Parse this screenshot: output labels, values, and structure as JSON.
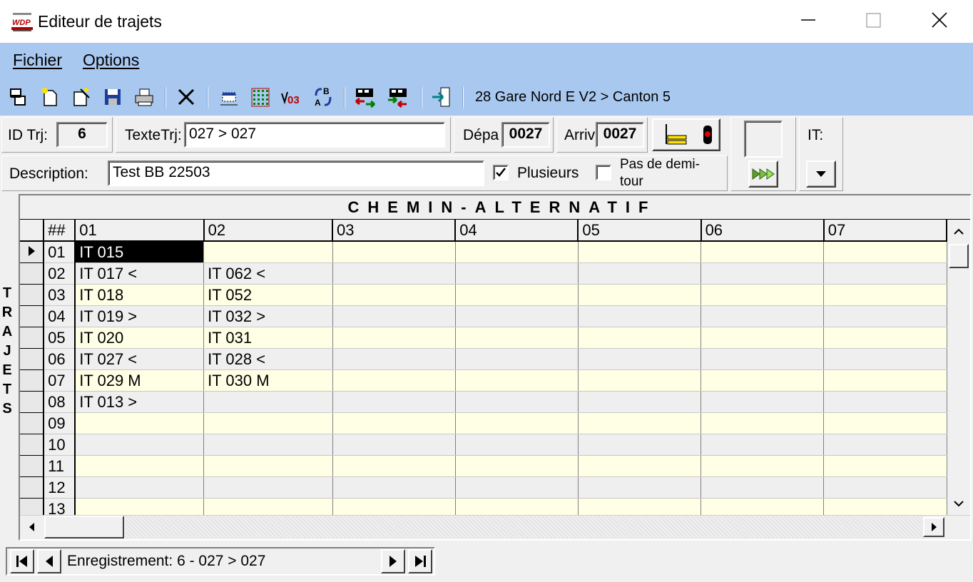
{
  "window": {
    "title": "Editeur de trajets",
    "app_icon": "wdp-logo-icon",
    "app_icon_text": "WDP",
    "controls": [
      "minimize-icon",
      "maximize-icon",
      "close-icon"
    ]
  },
  "menu": {
    "items": [
      {
        "label": "Fichier"
      },
      {
        "label": "Options"
      }
    ]
  },
  "toolbar": {
    "icons": [
      "copy-record-icon",
      "new-record-icon",
      "new-wizard-icon",
      "save-icon",
      "print-icon",
      "delete-icon",
      "select-area-icon",
      "grid-icon",
      "route-03-icon",
      "swap-ab-icon",
      "train-import-icon",
      "train-export-icon",
      "exit-icon"
    ],
    "icon_03_text": "03",
    "status": "28 Gare Nord E V2 > Canton 5"
  },
  "form": {
    "id_label": "ID Trj:",
    "id_value": "6",
    "texte_label": "TexteTrj:",
    "texte_value": "027 > 027",
    "depart_label": "Dépa",
    "depart_value": "0027",
    "arrivee_label": "Arriv",
    "arrivee_value": "0027",
    "description_label": "Description:",
    "description_value": "Test BB 22503",
    "plusieurs_label": "Plusieurs",
    "plusieurs_checked": true,
    "pas_demi_tour_label": "Pas de demi-tour",
    "pas_demi_tour_checked": false,
    "it_label": "IT:",
    "it_value": ""
  },
  "grid": {
    "title": "CHEMIN-ALTERNATIF",
    "side_label": [
      "T",
      "R",
      "A",
      "J",
      "E",
      "T",
      "S"
    ],
    "corner_header": "##",
    "columns": [
      "01",
      "02",
      "03",
      "04",
      "05",
      "06",
      "07"
    ],
    "rows": [
      {
        "num": "01",
        "cells": [
          "IT 015",
          "",
          "",
          "",
          "",
          "",
          ""
        ]
      },
      {
        "num": "02",
        "cells": [
          "IT 017 <",
          "IT 062 <",
          "",
          "",
          "",
          "",
          ""
        ]
      },
      {
        "num": "03",
        "cells": [
          "IT 018",
          "IT 052",
          "",
          "",
          "",
          "",
          ""
        ]
      },
      {
        "num": "04",
        "cells": [
          "IT 019 >",
          "IT 032 >",
          "",
          "",
          "",
          "",
          ""
        ]
      },
      {
        "num": "05",
        "cells": [
          "IT 020",
          "IT 031",
          "",
          "",
          "",
          "",
          ""
        ]
      },
      {
        "num": "06",
        "cells": [
          "IT 027 <",
          "IT 028 <",
          "",
          "",
          "",
          "",
          ""
        ]
      },
      {
        "num": "07",
        "cells": [
          "IT 029 M",
          "IT 030 M",
          "",
          "",
          "",
          "",
          ""
        ]
      },
      {
        "num": "08",
        "cells": [
          "IT 013 >",
          "",
          "",
          "",
          "",
          "",
          ""
        ]
      },
      {
        "num": "09",
        "cells": [
          "",
          "",
          "",
          "",
          "",
          "",
          ""
        ]
      },
      {
        "num": "10",
        "cells": [
          "",
          "",
          "",
          "",
          "",
          "",
          ""
        ]
      },
      {
        "num": "11",
        "cells": [
          "",
          "",
          "",
          "",
          "",
          "",
          ""
        ]
      },
      {
        "num": "12",
        "cells": [
          "",
          "",
          "",
          "",
          "",
          "",
          ""
        ]
      },
      {
        "num": "13",
        "cells": [
          "",
          "",
          "",
          "",
          "",
          "",
          ""
        ]
      }
    ],
    "current_row": 0,
    "current_col": 0
  },
  "navigator": {
    "text": "Enregistrement: 6 - 027 > 027"
  },
  "colors": {
    "menu_bg": "#a8c8f0",
    "row_odd": "#ffffe6",
    "row_even": "#efefef",
    "selected_cell": "#000000"
  }
}
